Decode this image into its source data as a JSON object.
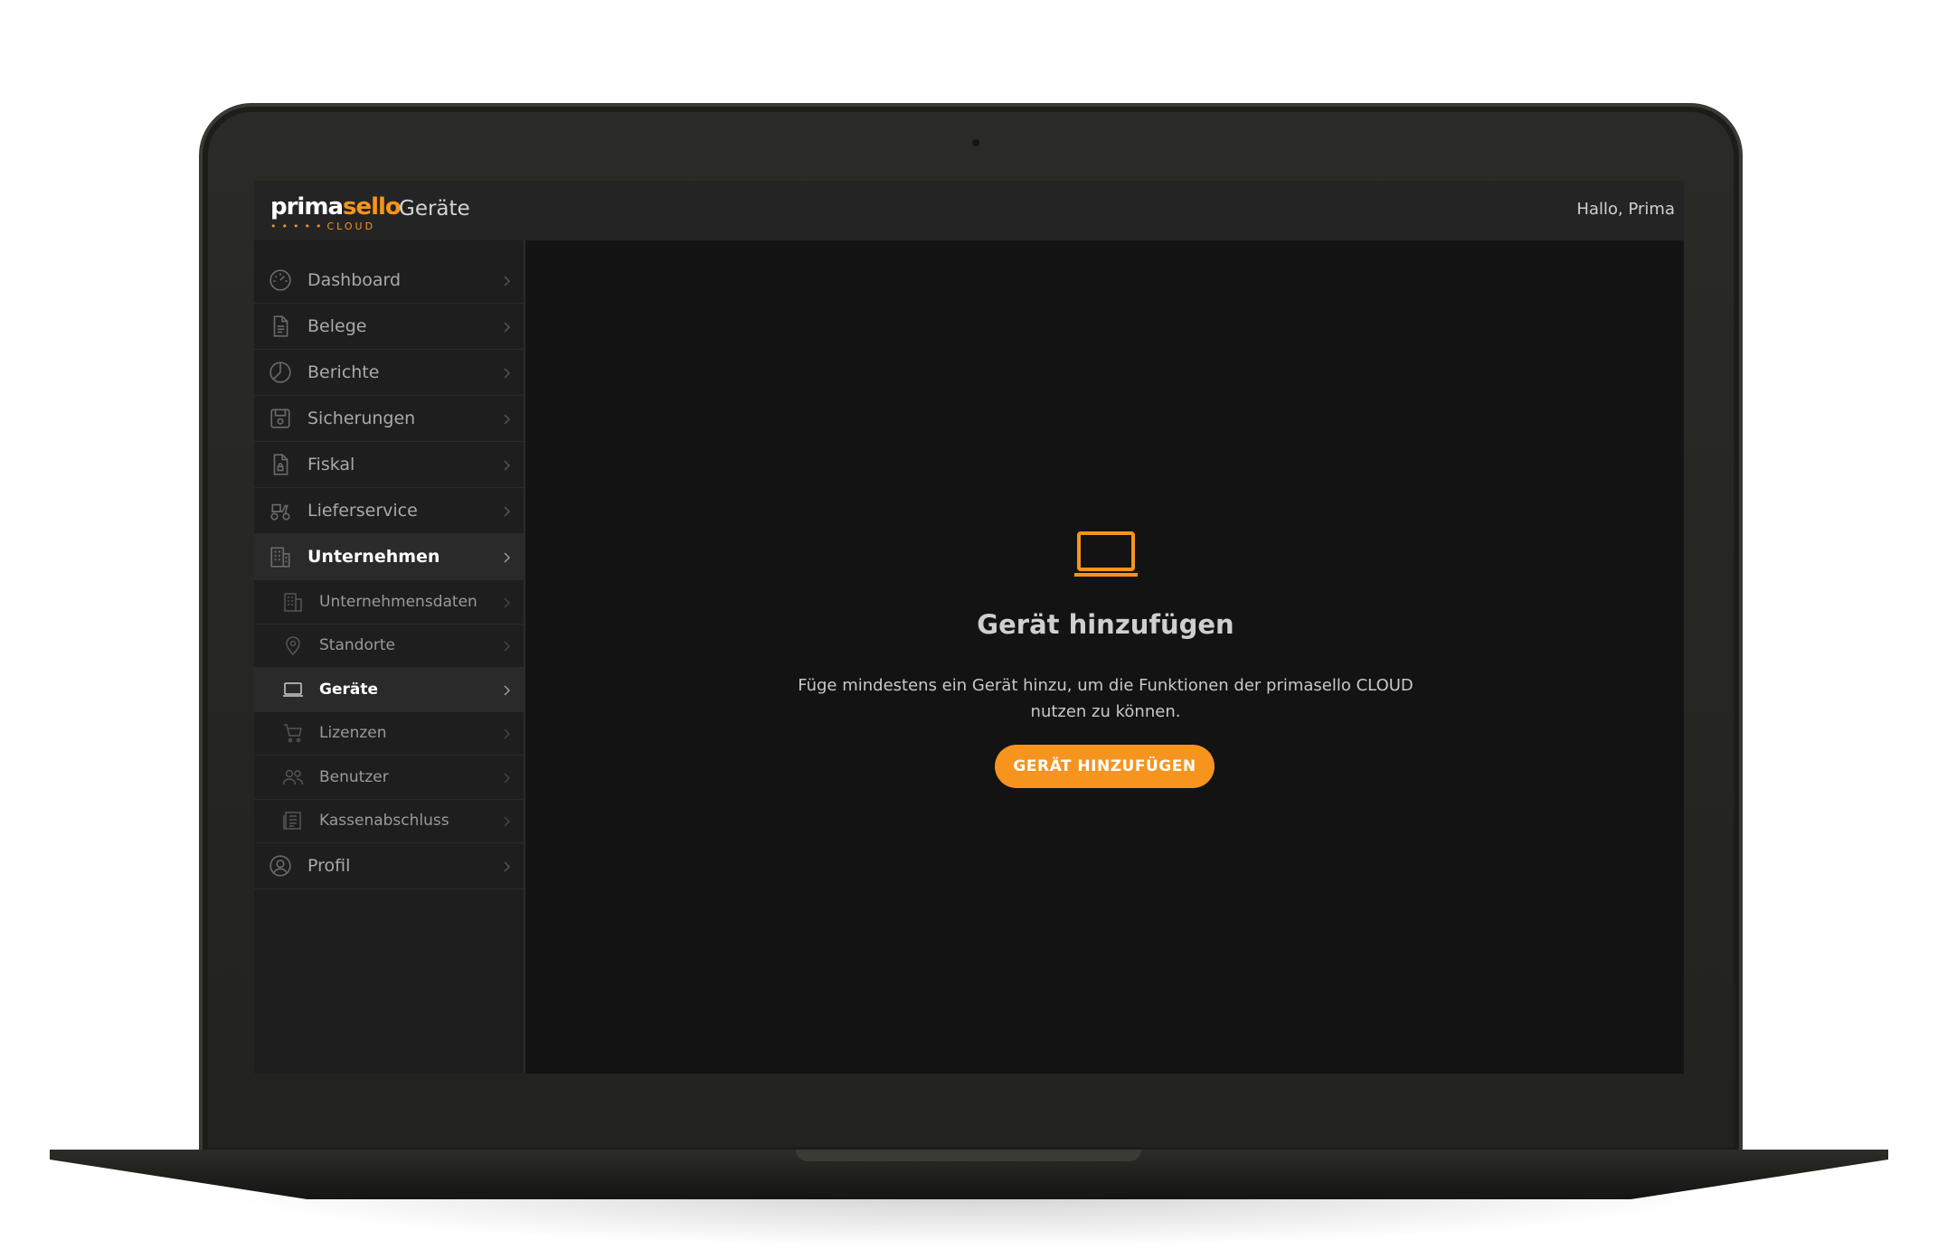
{
  "app": {
    "logo_main": "prima",
    "logo_accent": "sello",
    "logo_sub": "CLOUD",
    "page_title": "Geräte",
    "greeting": "Hallo, Prima"
  },
  "colors": {
    "accent": "#f7941d",
    "topbar": "#242424",
    "sidebar": "#1e1e1e",
    "content": "#131313"
  },
  "sidebar": {
    "items": [
      {
        "label": "Dashboard",
        "icon": "speedometer-icon"
      },
      {
        "label": "Belege",
        "icon": "document-icon"
      },
      {
        "label": "Berichte",
        "icon": "pie-chart-icon"
      },
      {
        "label": "Sicherungen",
        "icon": "floppy-disk-icon"
      },
      {
        "label": "Fiskal",
        "icon": "locked-document-icon"
      },
      {
        "label": "Lieferservice",
        "icon": "delivery-scooter-icon"
      },
      {
        "label": "Unternehmen",
        "icon": "building-icon"
      },
      {
        "label": "Profil",
        "icon": "user-circle-icon"
      }
    ],
    "subitems": [
      {
        "label": "Unternehmensdaten",
        "icon": "building-icon"
      },
      {
        "label": "Standorte",
        "icon": "location-pin-icon"
      },
      {
        "label": "Geräte",
        "icon": "laptop-icon"
      },
      {
        "label": "Lizenzen",
        "icon": "shopping-cart-icon"
      },
      {
        "label": "Benutzer",
        "icon": "users-icon"
      },
      {
        "label": "Kassenabschluss",
        "icon": "register-report-icon"
      }
    ],
    "active_parent": "Unternehmen",
    "active_item": "Geräte"
  },
  "main": {
    "empty_icon": "laptop-icon",
    "title": "Gerät hinzufügen",
    "description": "Füge mindestens ein Gerät hinzu, um die Funktionen der primasello CLOUD nutzen zu können.",
    "button_label": "GERÄT HINZUFÜGEN"
  }
}
